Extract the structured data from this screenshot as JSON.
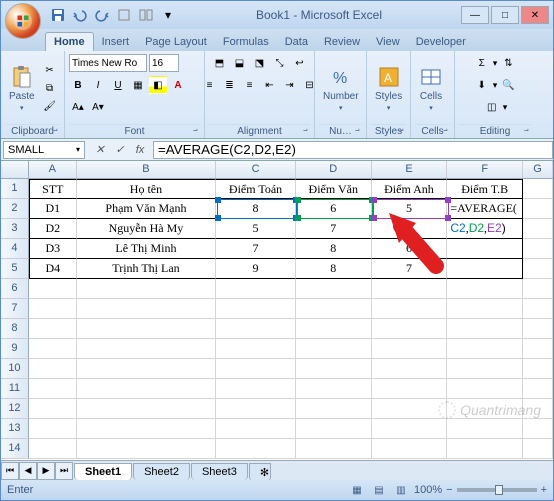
{
  "window": {
    "title": "Book1 - Microsoft Excel"
  },
  "tabs": [
    "Home",
    "Insert",
    "Page Layout",
    "Formulas",
    "Data",
    "Review",
    "View",
    "Developer"
  ],
  "ribbon": {
    "clipboard": {
      "label": "Clipboard",
      "paste": "Paste"
    },
    "font": {
      "label": "Font",
      "name": "Times New Ro",
      "size": "16"
    },
    "alignment": {
      "label": "Alignment"
    },
    "number": {
      "label": "Nu…",
      "btn": "Number"
    },
    "styles": {
      "label": "Styles",
      "btn": "Styles"
    },
    "cells": {
      "label": "Cells",
      "btn": "Cells"
    },
    "editing": {
      "label": "Editing"
    }
  },
  "formula_bar": {
    "name_box": "SMALL",
    "formula": "=AVERAGE(C2,D2,E2)"
  },
  "columns": [
    "A",
    "B",
    "C",
    "D",
    "E",
    "F",
    "G"
  ],
  "row_numbers": [
    "1",
    "2",
    "3",
    "4",
    "5",
    "6",
    "7",
    "8",
    "9",
    "10",
    "11",
    "12",
    "13",
    "14"
  ],
  "table": {
    "header": {
      "stt": "STT",
      "hoten": "Họ tên",
      "toan": "Điểm Toán",
      "van": "Điểm Văn",
      "anh": "Điểm Anh",
      "tb": "Điểm T.B"
    },
    "rows": [
      {
        "stt": "D1",
        "hoten": "Phạm Văn Mạnh",
        "toan": "8",
        "van": "6",
        "anh": "5",
        "tb": "=AVERAGE("
      },
      {
        "stt": "D2",
        "hoten": "Nguyễn Hà My",
        "toan": "5",
        "van": "7",
        "anh": "6",
        "tb_parts": {
          "c": "C2",
          "d": "D2",
          "e": "E2",
          "close": ")"
        }
      },
      {
        "stt": "D3",
        "hoten": "Lê Thị Minh",
        "toan": "7",
        "van": "8",
        "anh": "6",
        "tb": ""
      },
      {
        "stt": "D4",
        "hoten": "Trịnh Thị Lan",
        "toan": "9",
        "van": "8",
        "anh": "7",
        "tb": ""
      }
    ]
  },
  "sheets": [
    "Sheet1",
    "Sheet2",
    "Sheet3"
  ],
  "status": {
    "mode": "Enter",
    "zoom": "100%"
  },
  "watermark": "Quantrimang"
}
